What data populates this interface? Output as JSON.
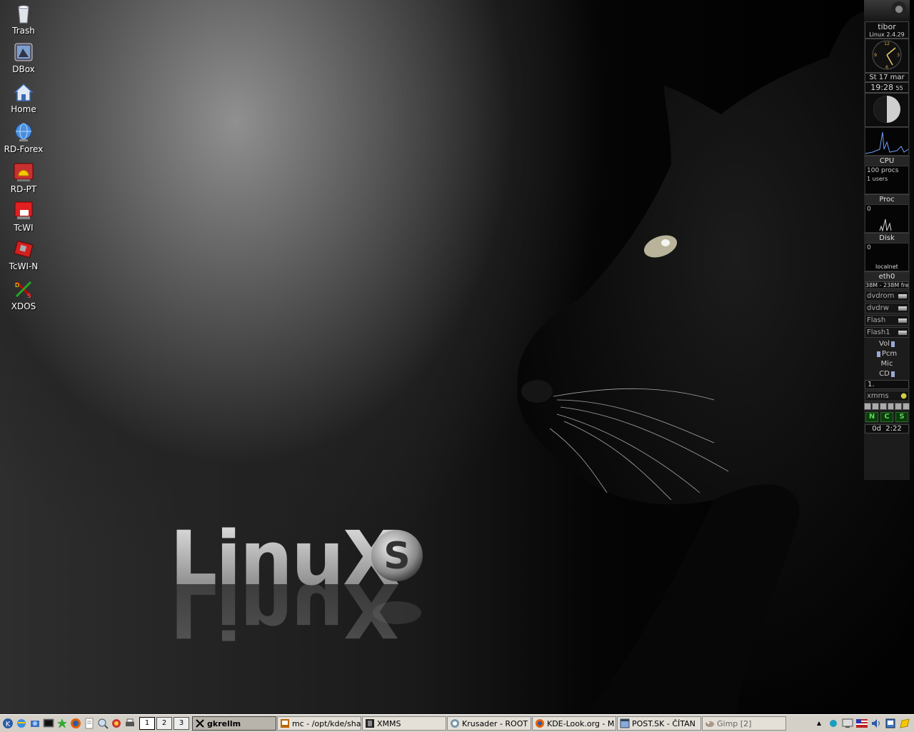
{
  "desktop": {
    "icons": [
      {
        "label": "Trash"
      },
      {
        "label": "DBox"
      },
      {
        "label": "Home"
      },
      {
        "label": "RD-Forex"
      },
      {
        "label": "RD-PT"
      },
      {
        "label": "TcWI"
      },
      {
        "label": "TcWI-N"
      },
      {
        "label": "XDOS"
      }
    ]
  },
  "wallpaper": {
    "logo_text": "LinuX",
    "logo_badge": "S"
  },
  "gkrellm": {
    "hostname": "tibor",
    "kernel": "Linux 2.4.29",
    "date": "St 17 mar",
    "time": "19:28",
    "seconds": "55",
    "cpu_label": "CPU",
    "proc_text1": "100 procs",
    "proc_text2": "1 users",
    "proc_label": "Proc",
    "disk_value": "0",
    "disk_label": "Disk",
    "net_value": "0",
    "net_host": "localnet",
    "net_label": "eth0",
    "mem_text": "38M - 238M fre",
    "mounts": [
      "dvdrom",
      "dvdrw",
      "Flash",
      "Flash1"
    ],
    "mixer": [
      "Vol",
      "Pcm",
      "Mic",
      "CD"
    ],
    "xmms_track": "1.",
    "xmms_label": "xmms",
    "ncs": [
      "N",
      "C",
      "S"
    ],
    "uptime": "0d  2:22"
  },
  "taskbar": {
    "pager": [
      "1",
      "2",
      "3"
    ],
    "tasks": [
      {
        "label": "gkrellm",
        "active": true
      },
      {
        "label": "mc - /opt/kde/sha"
      },
      {
        "label": "XMMS"
      },
      {
        "label": "Krusader - ROOT"
      },
      {
        "label": "KDE-Look.org - M"
      },
      {
        "label": "POST.SK - ČÍTAN"
      },
      {
        "label": "Gimp [2]"
      }
    ]
  },
  "colors": {
    "gkrellm_bg": "#1c1c1c",
    "taskbar_bg": "#d4d0c8",
    "cpu_graph": "#6fa0ff"
  }
}
